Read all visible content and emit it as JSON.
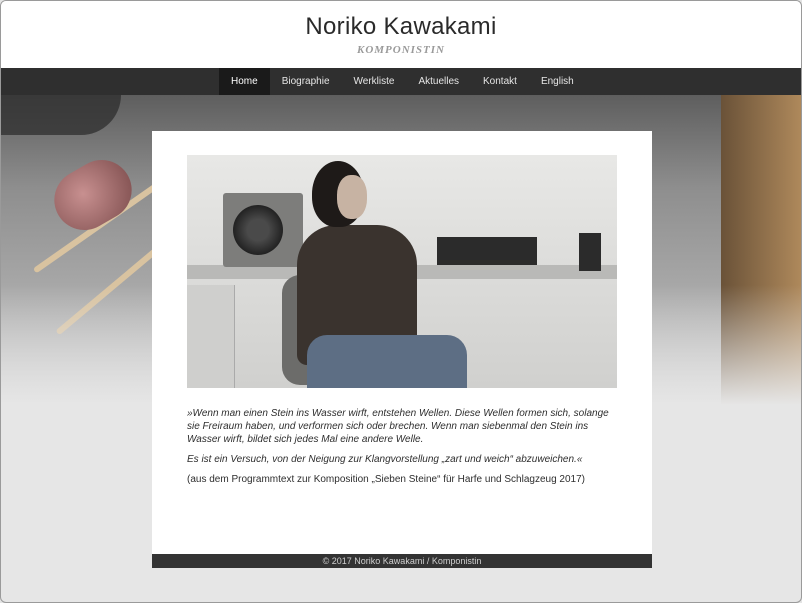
{
  "header": {
    "title": "Noriko Kawakami",
    "subtitle": "KOMPONISTIN"
  },
  "nav": {
    "items": [
      {
        "label": "Home",
        "active": true
      },
      {
        "label": "Biographie",
        "active": false
      },
      {
        "label": "Werkliste",
        "active": false
      },
      {
        "label": "Aktuelles",
        "active": false
      },
      {
        "label": "Kontakt",
        "active": false
      },
      {
        "label": "English",
        "active": false
      }
    ]
  },
  "main": {
    "quote_line1": "»Wenn man einen Stein ins Wasser wirft, entstehen Wellen. Diese Wellen formen sich, solange sie Freiraum haben, und verformen sich oder brechen. Wenn man siebenmal den Stein ins Wasser wirft, bildet sich jedes Mal eine andere Welle.",
    "quote_line2": "Es ist ein Versuch, von der Neigung zur Klangvorstellung „zart und weich“ abzuweichen.«",
    "source": "(aus dem Programmtext zur Komposition „Sieben Steine“ für Harfe und Schlagzeug 2017)"
  },
  "footer": {
    "text": "© 2017 Noriko Kawakami / Komponistin"
  },
  "colors": {
    "nav_bg": "#2f2f2f",
    "nav_active_bg": "#1a1a1a",
    "footer_bg": "#333333",
    "page_bg": "#e6e6e6"
  }
}
